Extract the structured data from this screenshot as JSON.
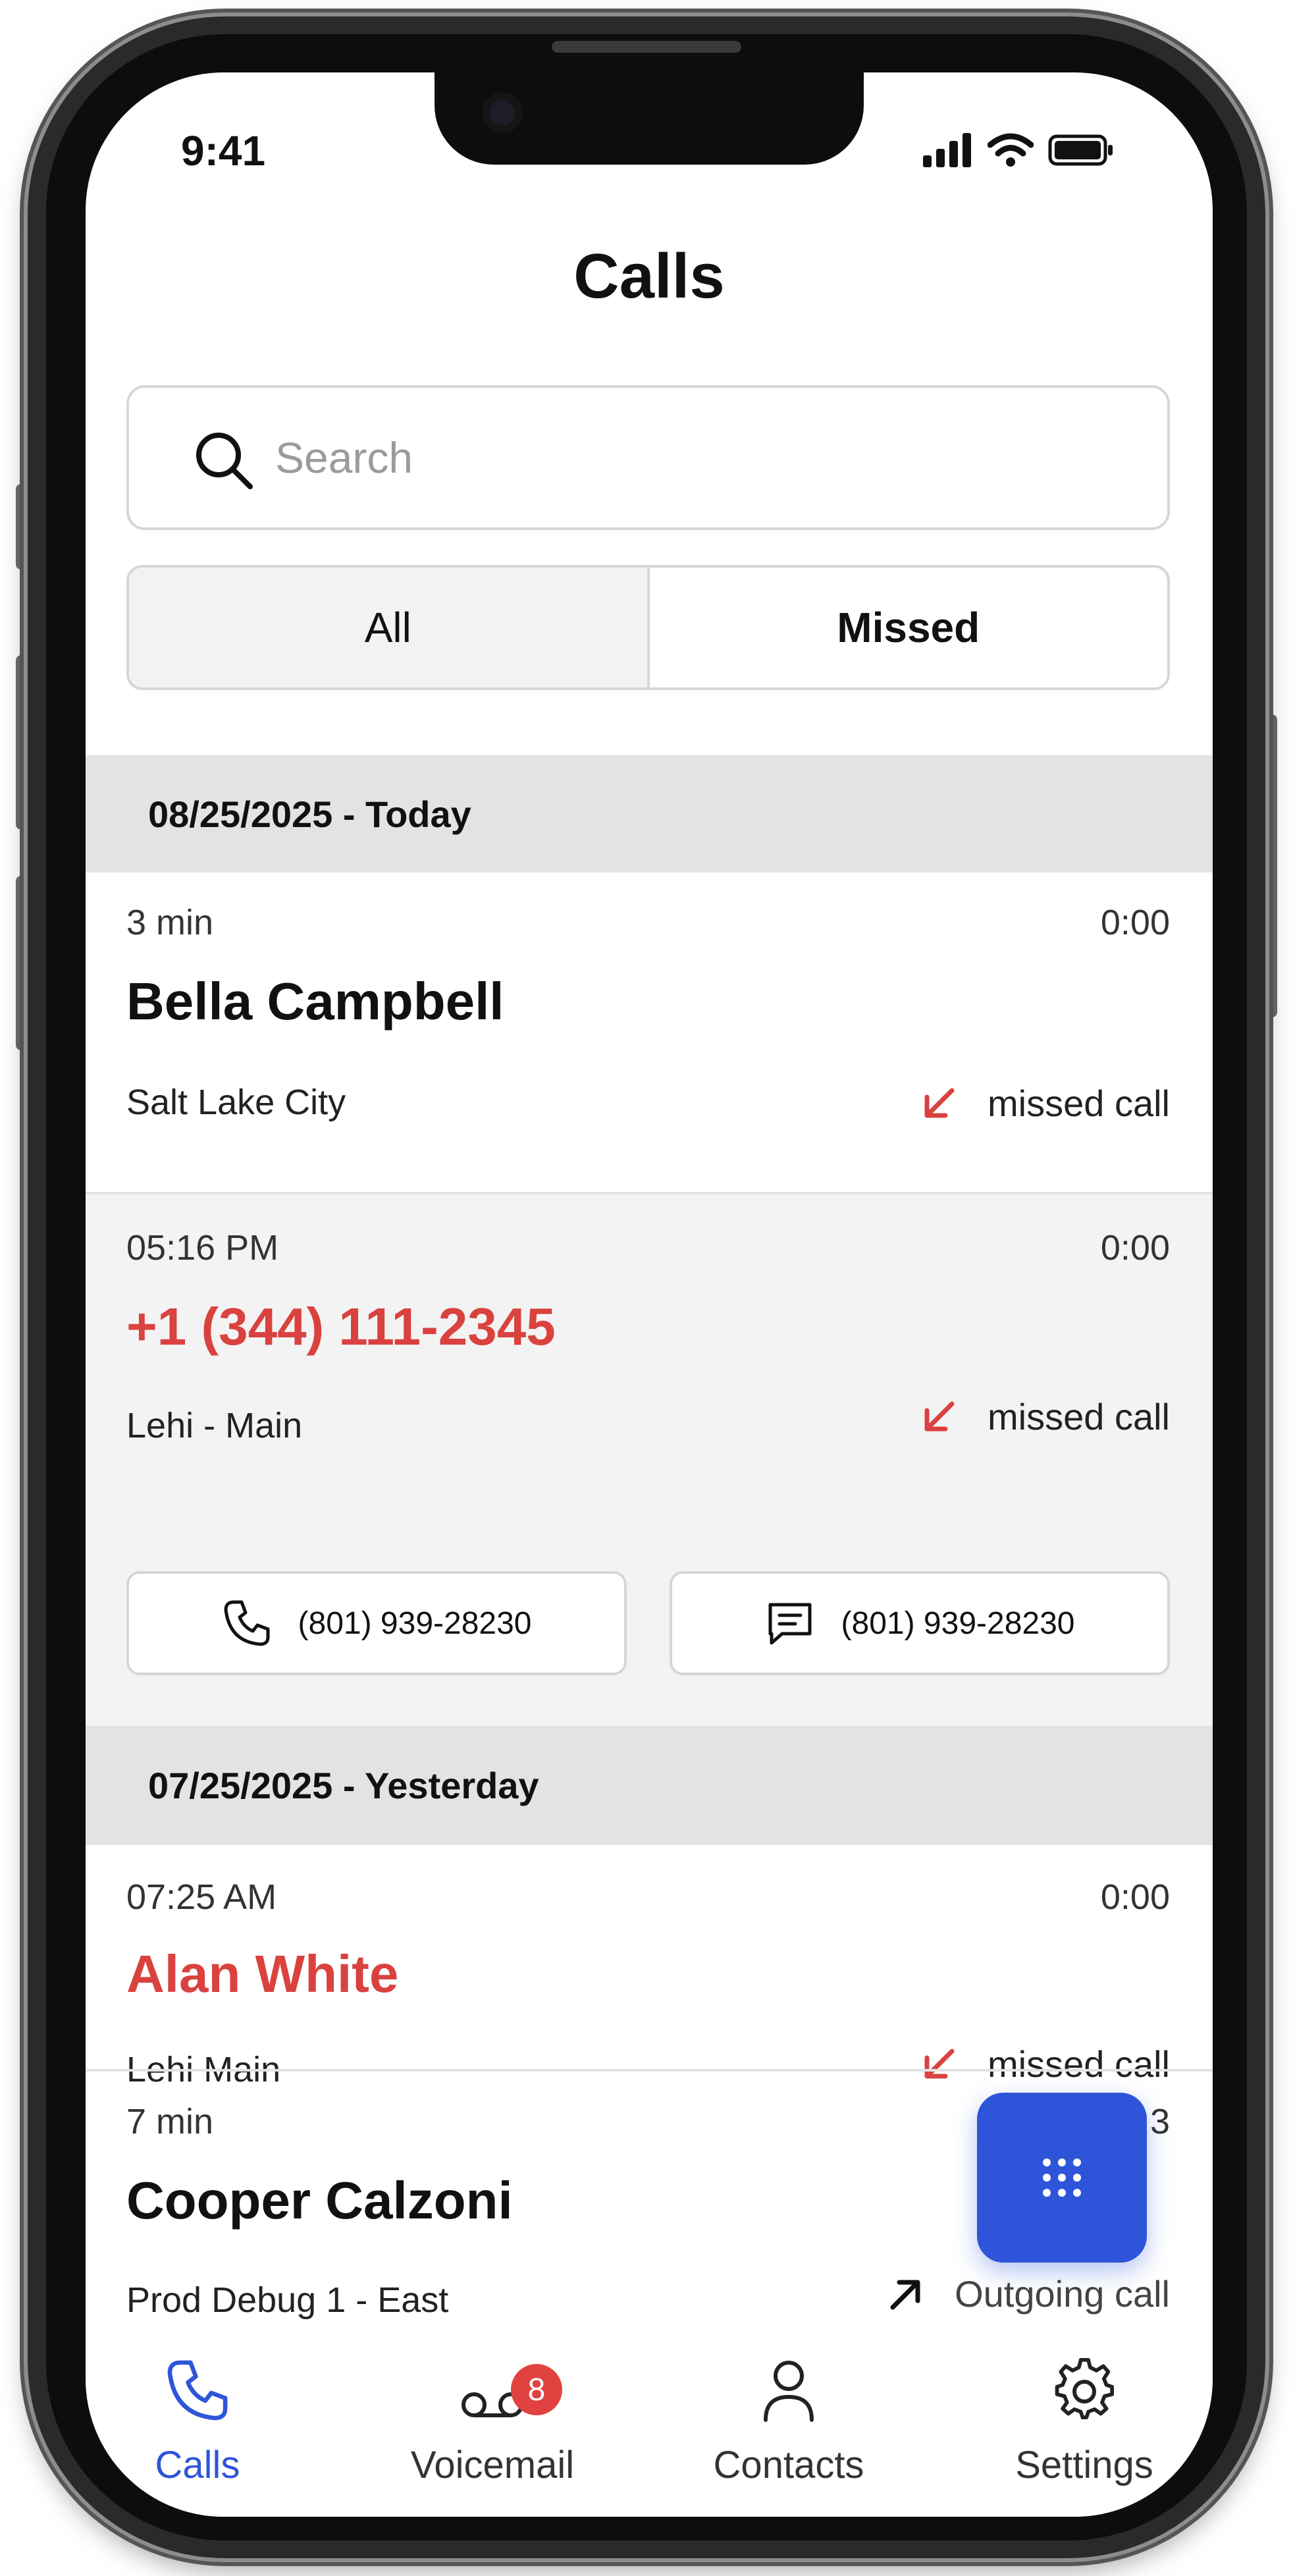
{
  "status_bar": {
    "time": "9:41"
  },
  "header": {
    "title": "Calls"
  },
  "search": {
    "placeholder": "Search"
  },
  "filter_tabs": {
    "all": "All",
    "missed": "Missed"
  },
  "sections": [
    {
      "label": "08/25/2025 - Today"
    },
    {
      "label": "07/25/2025 - Yesterday"
    }
  ],
  "calls": [
    {
      "time": "3 min",
      "duration": "0:00",
      "name": "Bella Campbell",
      "location": "Salt Lake City",
      "type": "missed call"
    },
    {
      "time": "05:16 PM",
      "duration": "0:00",
      "name": "+1 (344) 111-2345",
      "location": "Lehi - Main",
      "type": "missed call",
      "actions": {
        "call_number": "(801) 939-28230",
        "message_number": "(801) 939-28230"
      }
    },
    {
      "time": "07:25 AM",
      "duration": "0:00",
      "name": "Alan White",
      "location": "Lehi Main",
      "type": "missed call"
    },
    {
      "time": "7 min",
      "duration": "3",
      "name": "Cooper Calzoni",
      "location": "Prod Debug 1 - East",
      "type": "Outgoing call"
    }
  ],
  "tab_bar": {
    "calls": "Calls",
    "voicemail": "Voicemail",
    "voicemail_badge": "8",
    "contacts": "Contacts",
    "settings": "Settings"
  },
  "colors": {
    "accent": "#2e55d9",
    "missed": "#d9423f",
    "section_bg": "#e3e3e5"
  }
}
